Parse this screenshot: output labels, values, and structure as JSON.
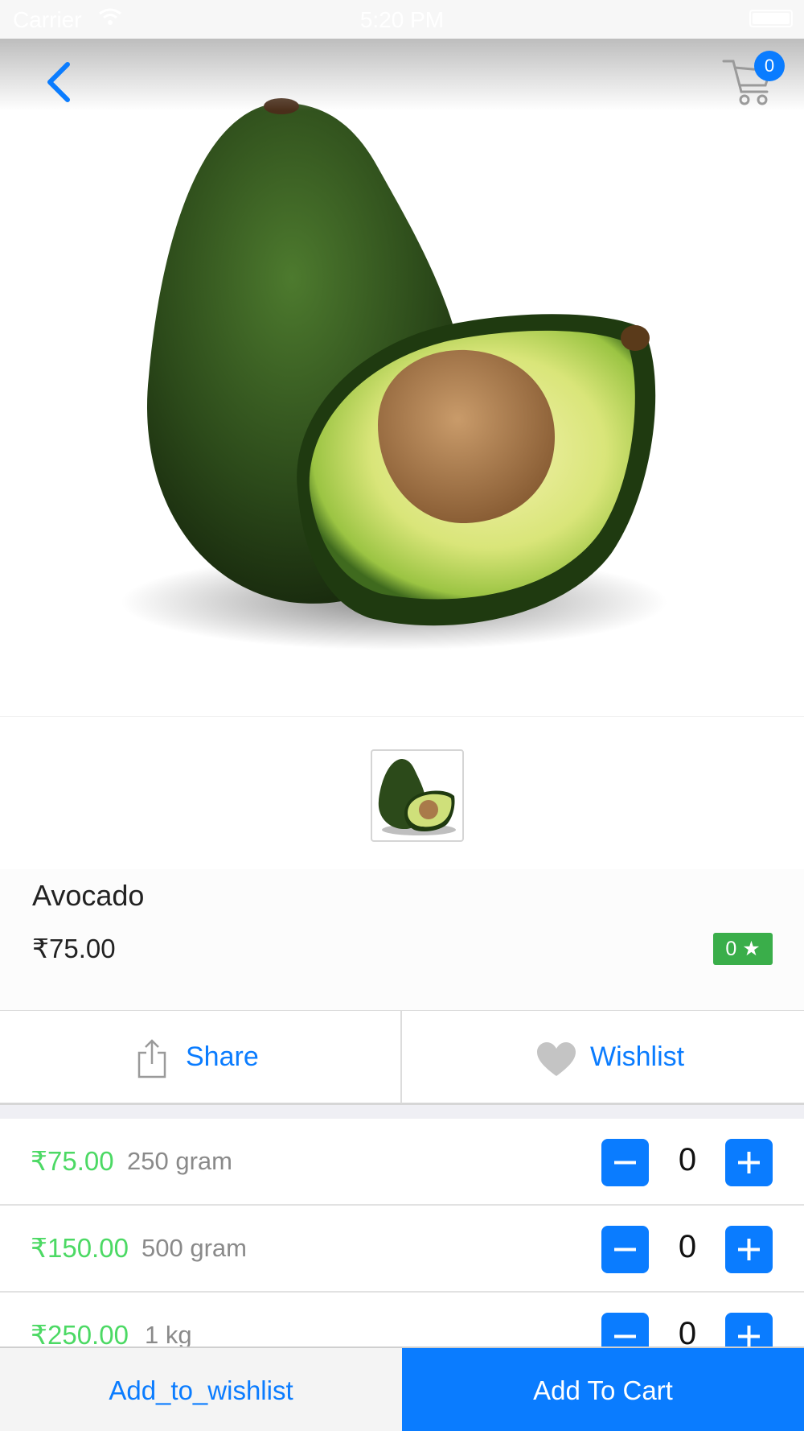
{
  "status_bar": {
    "carrier": "Carrier",
    "time": "5:20 PM"
  },
  "header": {
    "back_icon": "chevron-left-icon",
    "cart_icon": "shopping-cart-icon",
    "cart_count": "0"
  },
  "product": {
    "name": "Avocado",
    "price": "₹75.00",
    "rating": "0 ★",
    "image": "avocado-product-photo"
  },
  "actions": {
    "share_label": "Share",
    "wishlist_label": "Wishlist"
  },
  "variants": [
    {
      "price": "₹75.00",
      "size": "250 gram",
      "quantity": "0"
    },
    {
      "price": "₹150.00",
      "size": "500 gram",
      "quantity": "0"
    },
    {
      "price": "₹250.00",
      "size": "1 kg",
      "quantity": "0"
    }
  ],
  "bottom_bar": {
    "wishlist_label": "Add_to_wishlist",
    "cart_label": "Add To Cart"
  },
  "colors": {
    "accent": "#0a7cff",
    "price_green": "#4cd964",
    "rating_green": "#3aae4a"
  }
}
